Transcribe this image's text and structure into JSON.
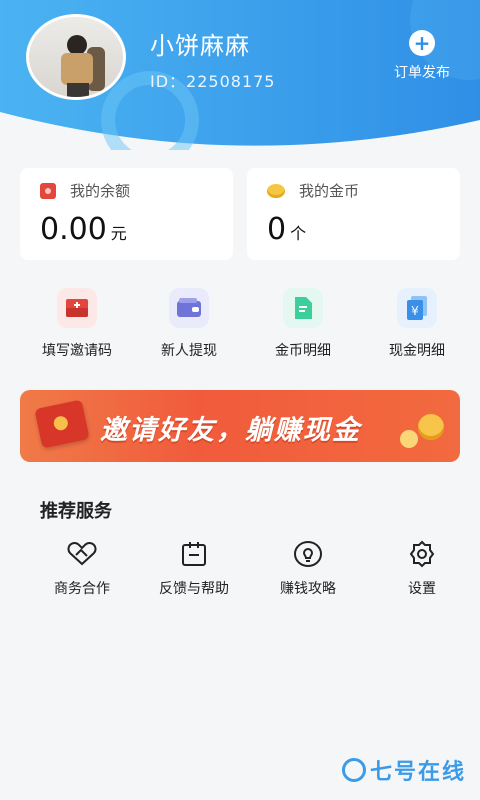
{
  "profile": {
    "name": "小饼麻麻",
    "id_label": "ID：22508175"
  },
  "header": {
    "publish_label": "订单发布",
    "accent": "#2f8fe6"
  },
  "cards": {
    "balance": {
      "title": "我的余额",
      "amount": "0.00",
      "unit": "元"
    },
    "coins": {
      "title": "我的金币",
      "amount": "0",
      "unit": "个"
    }
  },
  "quick_actions": [
    {
      "label": "填写邀请码",
      "icon": "invite-code-icon"
    },
    {
      "label": "新人提现",
      "icon": "wallet-icon"
    },
    {
      "label": "金币明细",
      "icon": "document-icon"
    },
    {
      "label": "现金明细",
      "icon": "yuan-card-icon"
    }
  ],
  "banner": {
    "text": "邀请好友，躺赚现金"
  },
  "services": {
    "title": "推荐服务",
    "items": [
      {
        "label": "商务合作",
        "icon": "handshake-icon"
      },
      {
        "label": "反馈与帮助",
        "icon": "clipboard-icon"
      },
      {
        "label": "赚钱攻略",
        "icon": "lightbulb-icon"
      },
      {
        "label": "设置",
        "icon": "gear-icon"
      }
    ]
  },
  "watermark": {
    "text": "七号在线"
  }
}
